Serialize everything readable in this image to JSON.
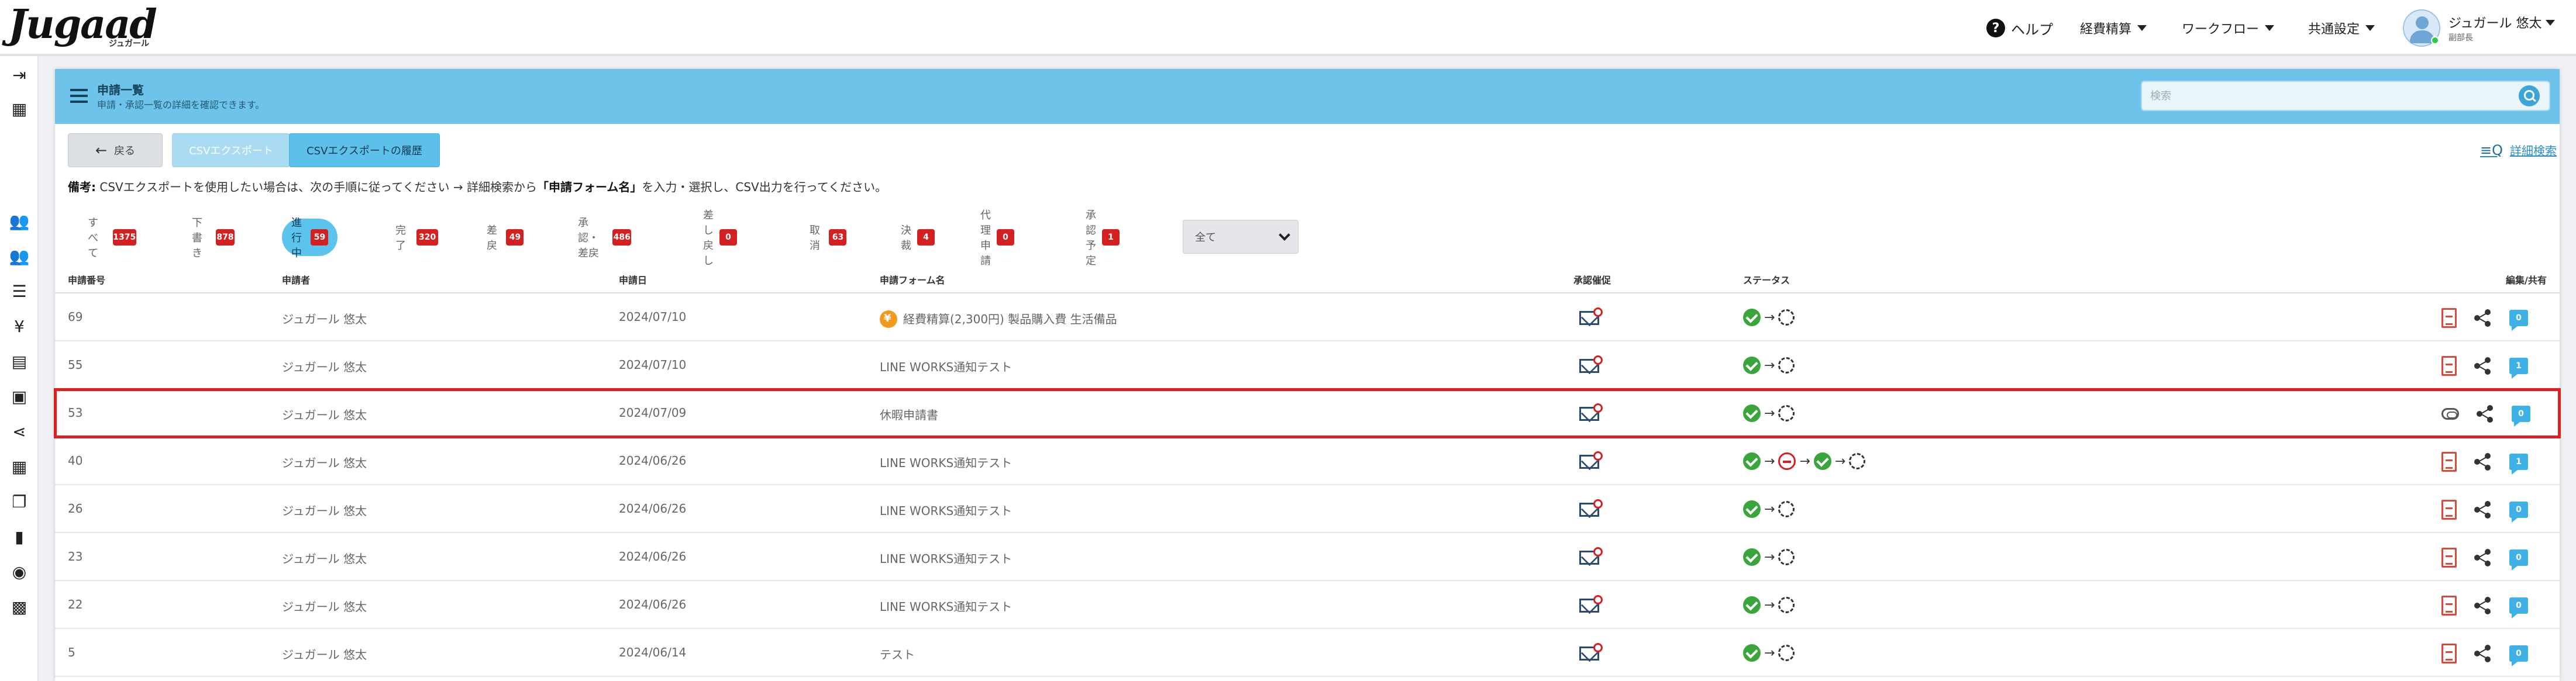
{
  "app": {
    "logo": "Jugaad",
    "logo_sub": "ジュガール"
  },
  "nav": {
    "help": "ヘルプ",
    "menus": [
      "経費精算",
      "ワークフロー",
      "共通設定"
    ],
    "user_name": "ジュガール 悠太",
    "user_role": "副部長"
  },
  "sidebar": {
    "icons": [
      "menu-expand-icon",
      "building-icon",
      "users-icon",
      "user-group-icon",
      "list-icon",
      "yen-icon",
      "document-icon",
      "receipt-icon",
      "share-icon",
      "table-icon",
      "copy-icon",
      "file-icon",
      "globe-user-icon",
      "wallet-icon"
    ]
  },
  "header": {
    "title": "申請一覧",
    "subtitle": "申請・承認一覧の詳細を確認できます。",
    "search_placeholder": "検索"
  },
  "toolbar": {
    "back": "戻る",
    "csv_export": "CSVエクスポート",
    "csv_history": "CSVエクスポートの履歴",
    "detail_search": "詳細検索"
  },
  "note": {
    "label": "備考:",
    "text_before": "CSVエクスポートを使用したい場合は、次の手順に従ってください → 詳細検索から",
    "bold": "「申請フォーム名」",
    "text_after": "を入力・選択し、CSV出力を行ってください。"
  },
  "tabs": [
    {
      "label": "すべて",
      "count": "1375"
    },
    {
      "label": "下書き",
      "count": "878"
    },
    {
      "label": "進行中",
      "count": "59",
      "active": true
    },
    {
      "label": "完了",
      "count": "320"
    },
    {
      "label": "差戻",
      "count": "49"
    },
    {
      "label": "承認・差戻",
      "count": "486"
    },
    {
      "label": "差し戻し",
      "count": "0"
    },
    {
      "label": "取消",
      "count": "63"
    },
    {
      "label": "決裁",
      "count": "4"
    },
    {
      "label": "代理申請",
      "count": "0"
    },
    {
      "label": "承認予定",
      "count": "1"
    }
  ],
  "filter": {
    "selected": "全て"
  },
  "table": {
    "headers": {
      "no": "申請番号",
      "applicant": "申請者",
      "date": "申請日",
      "form": "申請フォーム名",
      "mail": "承認催促",
      "status": "ステータス",
      "edit": "編集/共有"
    },
    "rows": [
      {
        "no": "69",
        "applicant": "ジュガール 悠太",
        "date": "2024/07/10",
        "form": "経費精算(2,300円) 製品購入費 生活備品",
        "coin": true,
        "status": [
          "ok",
          "pending"
        ],
        "attach": "pdf",
        "comments": "0"
      },
      {
        "no": "55",
        "applicant": "ジュガール 悠太",
        "date": "2024/07/10",
        "form": "LINE WORKS通知テスト",
        "status": [
          "ok",
          "pending"
        ],
        "attach": "pdf",
        "comments": "1"
      },
      {
        "no": "53",
        "applicant": "ジュガール 悠太",
        "date": "2024/07/09",
        "form": "休暇申請書",
        "highlight": true,
        "status": [
          "ok",
          "pending"
        ],
        "attach": "clip",
        "comments": "0"
      },
      {
        "no": "40",
        "applicant": "ジュガール 悠太",
        "date": "2024/06/26",
        "form": "LINE WORKS通知テスト",
        "status": [
          "ok",
          "rejected",
          "ok",
          "pending"
        ],
        "attach": "pdf",
        "comments": "1"
      },
      {
        "no": "26",
        "applicant": "ジュガール 悠太",
        "date": "2024/06/26",
        "form": "LINE WORKS通知テスト",
        "status": [
          "ok",
          "pending"
        ],
        "attach": "pdf",
        "comments": "0"
      },
      {
        "no": "23",
        "applicant": "ジュガール 悠太",
        "date": "2024/06/26",
        "form": "LINE WORKS通知テスト",
        "status": [
          "ok",
          "pending"
        ],
        "attach": "pdf",
        "comments": "0"
      },
      {
        "no": "22",
        "applicant": "ジュガール 悠太",
        "date": "2024/06/26",
        "form": "LINE WORKS通知テスト",
        "status": [
          "ok",
          "pending"
        ],
        "attach": "pdf",
        "comments": "0"
      },
      {
        "no": "5",
        "applicant": "ジュガール 悠太",
        "date": "2024/06/14",
        "form": "テスト",
        "status": [
          "ok",
          "pending"
        ],
        "attach": "pdf",
        "comments": "0"
      }
    ]
  },
  "colors": {
    "header_bg": "#6dc3ea",
    "badge": "#d42020",
    "highlight": "#e0201f",
    "accent": "#3eb1e6"
  }
}
